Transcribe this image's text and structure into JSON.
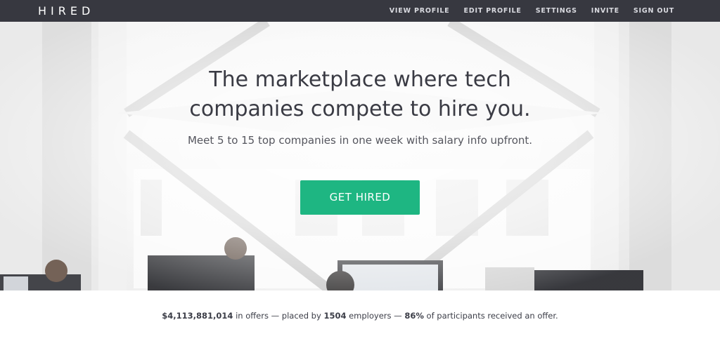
{
  "nav": {
    "logo": "HIRED",
    "links": [
      {
        "label": "VIEW PROFILE"
      },
      {
        "label": "EDIT PROFILE"
      },
      {
        "label": "SETTINGS"
      },
      {
        "label": "INVITE"
      },
      {
        "label": "SIGN OUT"
      }
    ]
  },
  "hero": {
    "headline_line1": "The marketplace where tech",
    "headline_line2": "companies compete to hire you.",
    "subheadline": "Meet 5 to 15 top companies in one week with salary info upfront.",
    "cta_label": "GET HIRED"
  },
  "stats": {
    "offers_amount": "$4,113,881,014",
    "offers_text": " in offers — placed by ",
    "employers_count": "1504",
    "employers_text": " employers — ",
    "participants_pct": "86%",
    "participants_text": " of participants received an offer."
  },
  "colors": {
    "navbar": "#373840",
    "cta": "#1eb682",
    "text": "#3b3d47"
  }
}
